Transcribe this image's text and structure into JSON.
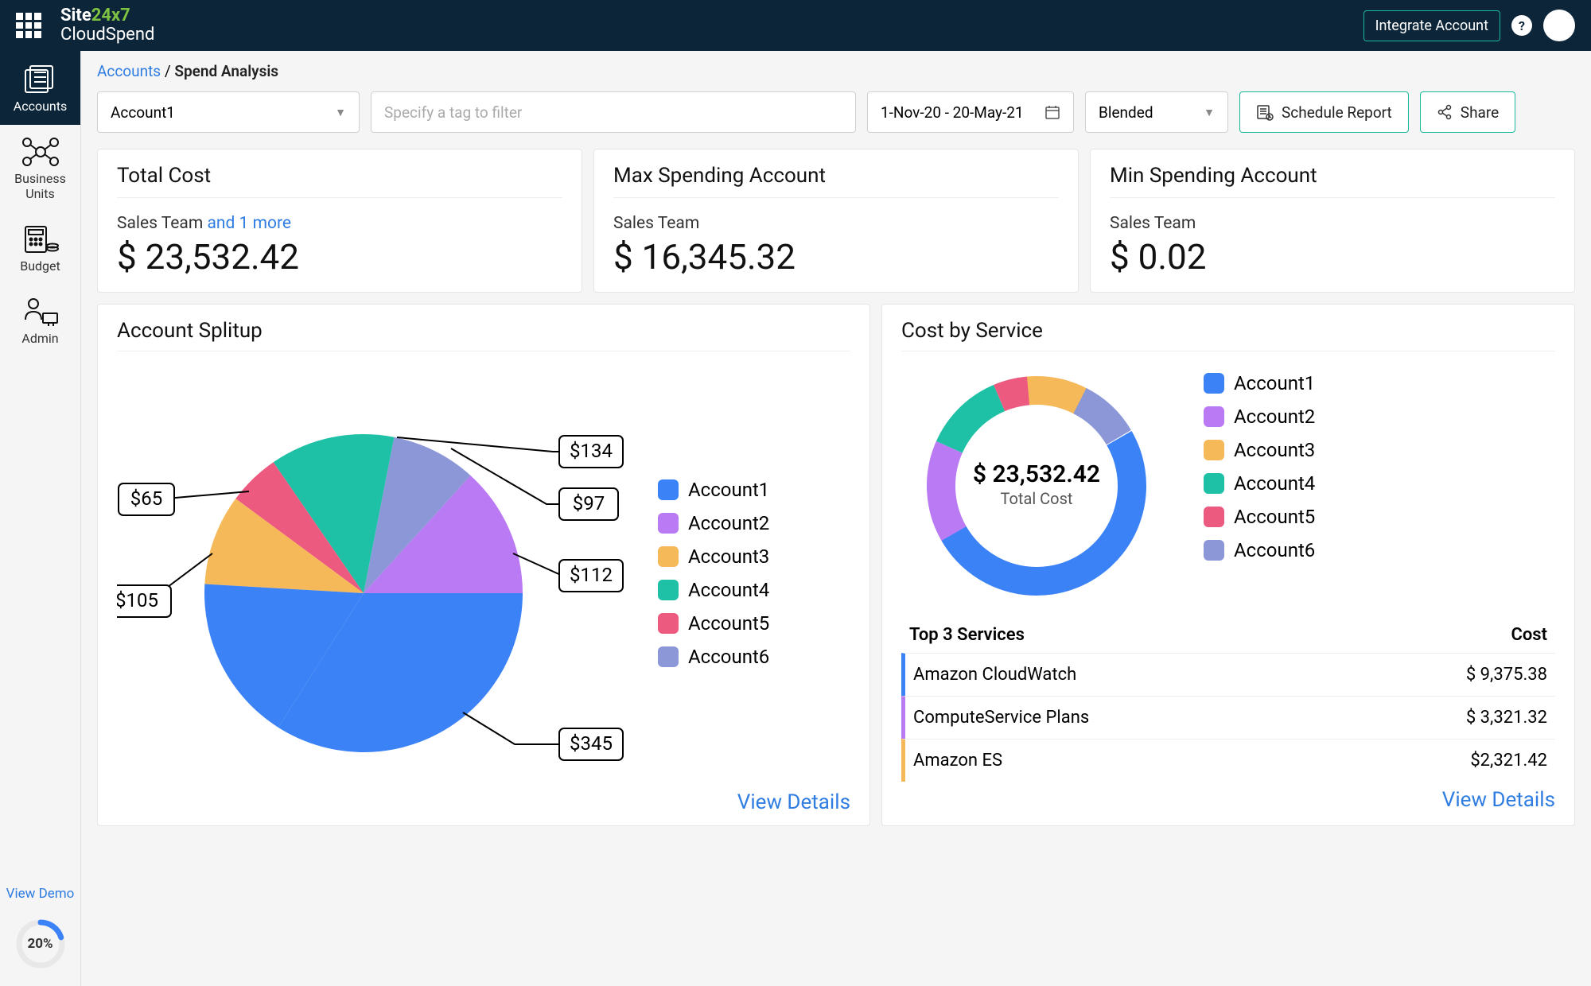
{
  "topnav": {
    "logo_brand_pre": "Site",
    "logo_brand_green": "24x7",
    "logo_sub": "CloudSpend",
    "integrate_label": "Integrate Account",
    "help_label": "?"
  },
  "sidebar": {
    "items": [
      {
        "label": "Accounts"
      },
      {
        "label": "Business Units"
      },
      {
        "label": "Budget"
      },
      {
        "label": "Admin"
      }
    ],
    "view_demo": "View Demo",
    "progress_pct": "20%"
  },
  "breadcrumb": {
    "root": "Accounts",
    "sep": " / ",
    "current": "Spend Analysis"
  },
  "filters": {
    "account": "Account1",
    "tag_placeholder": "Specify a tag to filter",
    "date_range": "1-Nov-20 - 20-May-21",
    "cost_type": "Blended",
    "schedule_label": "Schedule Report",
    "share_label": "Share"
  },
  "cards": {
    "total": {
      "title": "Total Cost",
      "subtitle": "Sales Team ",
      "extra": "and 1 more",
      "value": "$ 23,532.42"
    },
    "max": {
      "title": "Max Spending Account",
      "subtitle": "Sales Team",
      "value": "$ 16,345.32"
    },
    "min": {
      "title": "Min Spending Account",
      "subtitle": "Sales Team",
      "value": "$ 0.02"
    }
  },
  "splitup": {
    "title": "Account Splitup",
    "view_details": "View Details",
    "legend": [
      "Account1",
      "Account2",
      "Account3",
      "Account4",
      "Account5",
      "Account6"
    ],
    "callouts": [
      "$345",
      "$112",
      "$97",
      "$134",
      "$105",
      "$65"
    ]
  },
  "cost_by_service": {
    "title": "Cost by Service",
    "center_value": "$ 23,532.42",
    "center_label": "Total Cost",
    "legend": [
      "Account1",
      "Account2",
      "Account3",
      "Account4",
      "Account5",
      "Account6"
    ],
    "table_h1": "Top 3 Services",
    "table_h2": "Cost",
    "rows": [
      {
        "name": "Amazon CloudWatch",
        "cost": "$ 9,375.38"
      },
      {
        "name": "ComputeService Plans",
        "cost": "$ 3,321.32"
      },
      {
        "name": "Amazon ES",
        "cost": "$2,321.42"
      }
    ],
    "view_details": "View Details"
  },
  "colors": {
    "c1": "#3b82f6",
    "c2": "#b97af4",
    "c3": "#f6b95a",
    "c4": "#1fc1a6",
    "c5": "#ec5a80",
    "c6": "#8c97d8"
  },
  "chart_data": [
    {
      "type": "pie",
      "title": "Account Splitup",
      "categories": [
        "Account1",
        "Account2",
        "Account3",
        "Account4",
        "Account5",
        "Account6"
      ],
      "values": [
        345,
        112,
        97,
        134,
        105,
        65
      ],
      "value_labels": [
        "$345",
        "$112",
        "$97",
        "$134",
        "$105",
        "$65"
      ]
    },
    {
      "type": "pie",
      "title": "Cost by Service",
      "categories": [
        "Account1",
        "Account2",
        "Account3",
        "Account4",
        "Account5",
        "Account6"
      ],
      "values": [
        50,
        15,
        9,
        12,
        5,
        9
      ],
      "center_value": "$ 23,532.42",
      "center_label": "Total Cost"
    }
  ]
}
